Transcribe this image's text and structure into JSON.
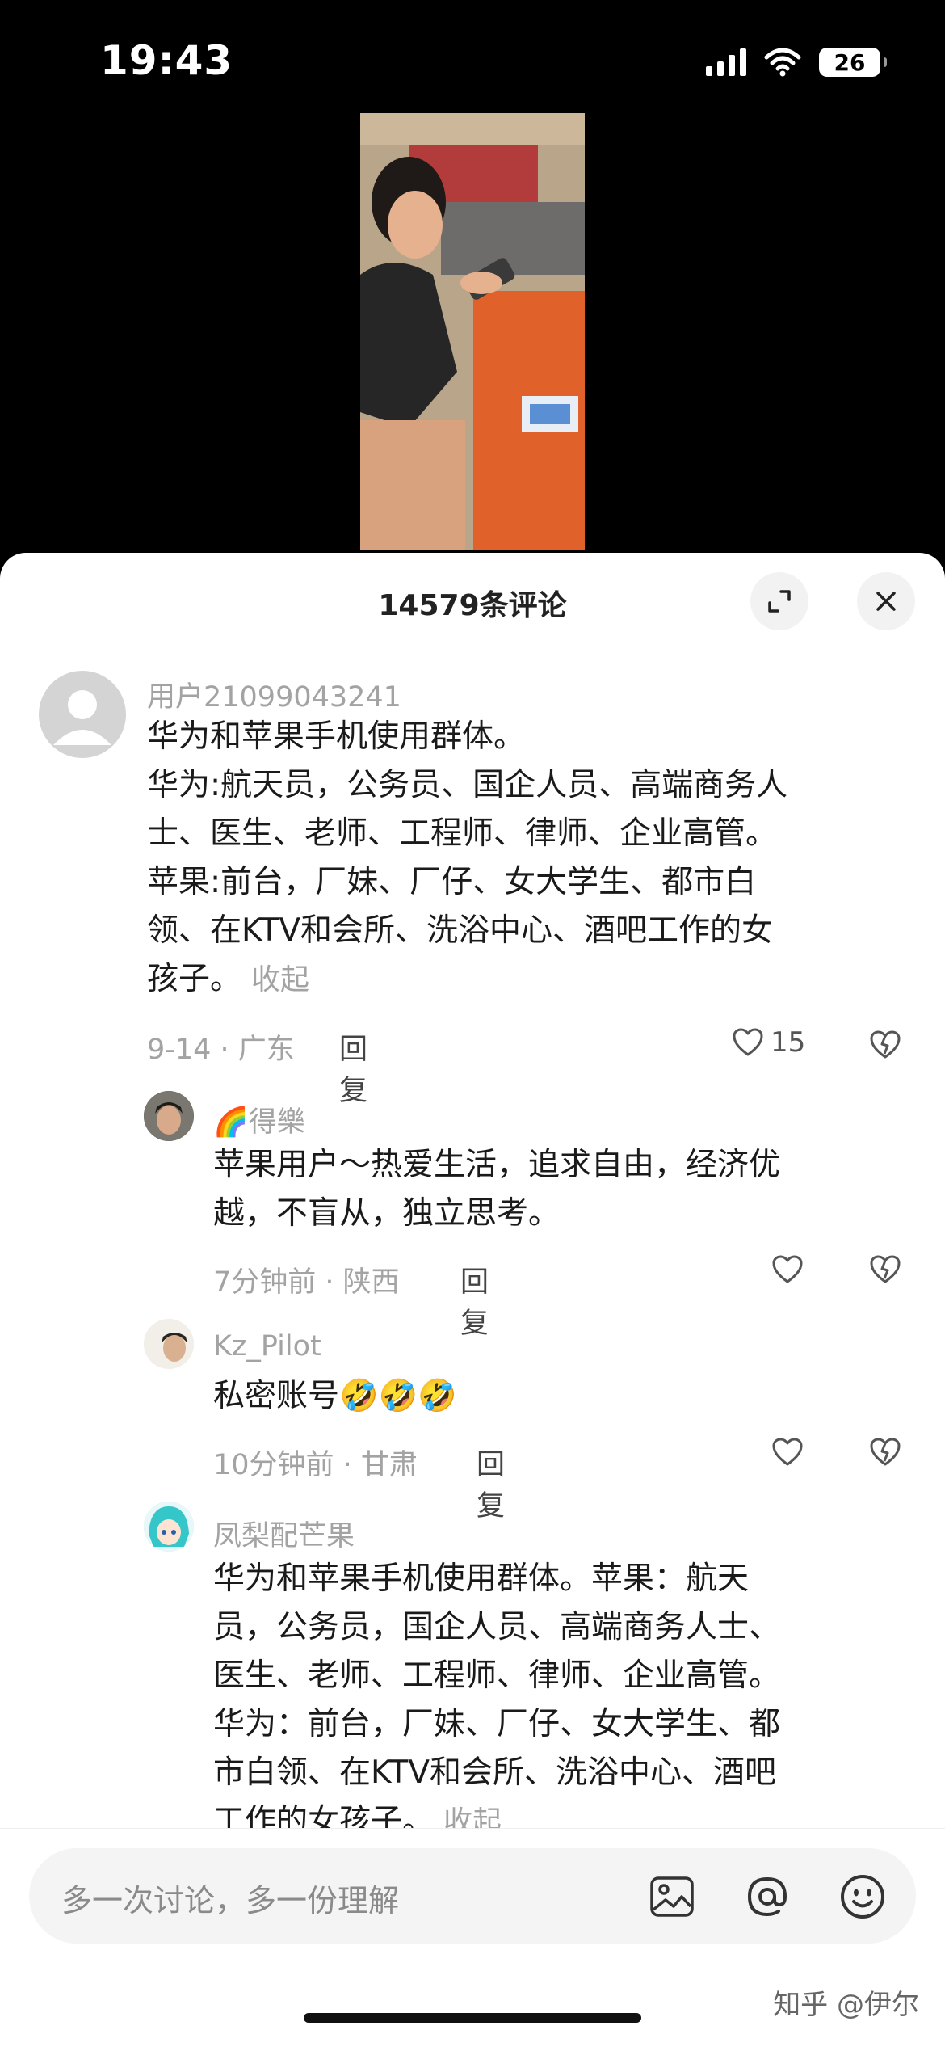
{
  "status": {
    "time": "19:43",
    "battery": "26"
  },
  "sheet": {
    "title": "14579条评论"
  },
  "comments": [
    {
      "username": "用户21099043241",
      "lines": [
        "华为和苹果手机使用群体。",
        "华为:航天员，公务员、国企人员、高端商务人",
        "士、医生、老师、工程师、律师、企业高管。",
        "苹果:前台，厂妹、厂仔、女大学生、都市白",
        "领、在KTV和会所、洗浴中心、酒吧工作的女",
        "孩子。"
      ],
      "collapse": "收起",
      "meta": "9-14 · 广东",
      "reply": "回复",
      "likes": "15"
    },
    {
      "username": "🌈得樂",
      "lines": [
        "苹果用户～热爱生活，追求自由，经济优",
        "越，不盲从，独立思考。"
      ],
      "meta": "7分钟前 · 陕西",
      "reply": "回复"
    },
    {
      "username": "Kz_Pilot",
      "lines": [
        "私密账号🤣🤣🤣"
      ],
      "meta": "10分钟前 · 甘肃",
      "reply": "回复"
    },
    {
      "username": "凤梨配芒果",
      "lines": [
        "华为和苹果手机使用群体。苹果：航天",
        "员，公务员，国企人员、高端商务人士、",
        "医生、老师、工程师、律师、企业高管。",
        "华为：前台，厂妹、厂仔、女大学生、都",
        "市白领、在KTV和会所、洗浴中心、酒吧",
        "工作的女孩子。"
      ],
      "collapse": "收起"
    }
  ],
  "input": {
    "placeholder": "多一次讨论，多一份理解"
  },
  "watermark": "知乎 @伊尔",
  "icons": [
    "signal-icon",
    "wifi-icon",
    "battery-icon",
    "expand-icon",
    "close-icon",
    "heart-icon",
    "heart-broken-icon",
    "image-icon",
    "at-icon",
    "emoji-icon"
  ],
  "colors": {
    "background": "#000000",
    "sheet": "#ffffff",
    "muted": "#a3a3a3"
  }
}
